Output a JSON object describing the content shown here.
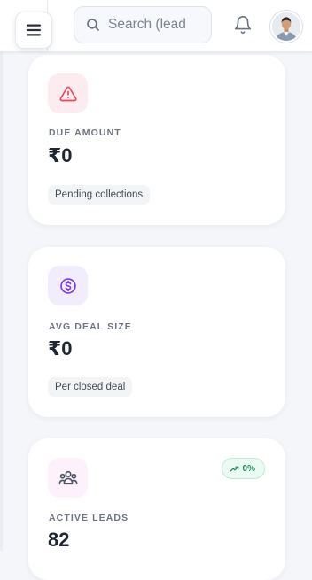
{
  "header": {
    "search_placeholder": "Search (lead",
    "icons": {
      "menu": "hamburger-menu-icon",
      "search": "search-icon",
      "bell": "bell-icon"
    }
  },
  "cards": [
    {
      "label": "DUE AMOUNT",
      "value": "₹0",
      "note": "Pending collections",
      "icon": "warning-triangle-icon",
      "icon_color": "#e5485a",
      "icon_bg": "#fdecef"
    },
    {
      "label": "AVG DEAL SIZE",
      "value": "₹0",
      "note": "Per closed deal",
      "icon": "dollar-circle-icon",
      "icon_color": "#7c3aed",
      "icon_bg": "#f2edfd"
    },
    {
      "label": "ACTIVE LEADS",
      "value": "82",
      "trend": "0%",
      "icon": "people-group-icon",
      "icon_color": "#4b5563",
      "icon_bg": "#fdf1fb"
    }
  ],
  "colors": {
    "page_bg": "#f4f6f9",
    "card_bg": "#ffffff",
    "trend_green": "#1a8a5b"
  }
}
